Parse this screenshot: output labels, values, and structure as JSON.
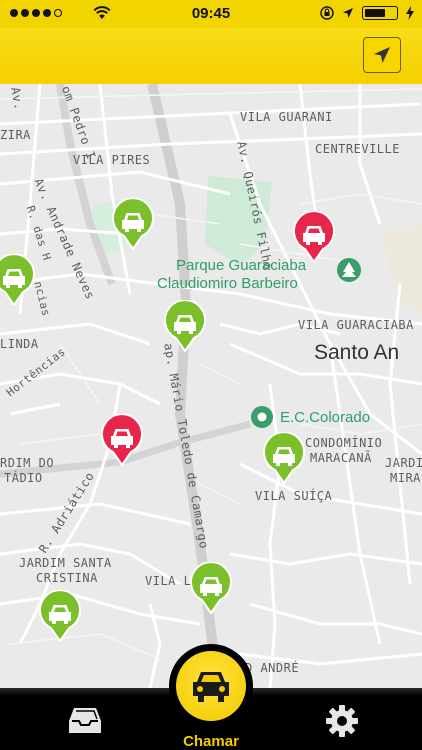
{
  "status_bar": {
    "time": "09:45",
    "signal_bars_filled": 4,
    "signal_bars_total": 5,
    "battery_level": 0.7
  },
  "header": {
    "locate_icon": "navigation-arrow-icon"
  },
  "map": {
    "labels": [
      "VILA GUARANI",
      "CENTREVILLE",
      "VILA PIRES",
      "Av. Queirós Filho",
      "om Pedro I",
      "ZIRA",
      "Av. Andrade Neves",
      "R. das H",
      "ncias",
      "LINDA",
      "Hortências",
      "ap. Mário Toledo de Camargo",
      "VILA GUARACIABA",
      "CONDOMÍNIO",
      "MARACANÃ",
      "JARDI",
      "MIRA",
      "RDIM DO",
      "TÁDIO",
      "R. Adriático",
      "VILA SUÍÇA",
      "JARDIM SANTA",
      "CRISTINA",
      "VILA L",
      "D ANDRÉ",
      "Av."
    ],
    "park_name_line1": "Parque Guaraciaba",
    "park_name_line2": "Claudiomiro Barbeiro",
    "city_name": "Santo An",
    "poi_name": "E.C.Colorado",
    "taxi_pins": [
      {
        "status": "available",
        "color": "#7bbf2a"
      },
      {
        "status": "available",
        "color": "#7bbf2a"
      },
      {
        "status": "available",
        "color": "#7bbf2a"
      },
      {
        "status": "available",
        "color": "#7bbf2a"
      },
      {
        "status": "available",
        "color": "#7bbf2a"
      },
      {
        "status": "available",
        "color": "#7bbf2a"
      },
      {
        "status": "busy",
        "color": "#e8254a"
      },
      {
        "status": "busy",
        "color": "#e8254a"
      }
    ]
  },
  "tab_bar": {
    "call_label": "Chamar",
    "inbox_icon": "inbox-icon",
    "settings_icon": "gear-icon",
    "accent_color": "#f4cc00"
  }
}
